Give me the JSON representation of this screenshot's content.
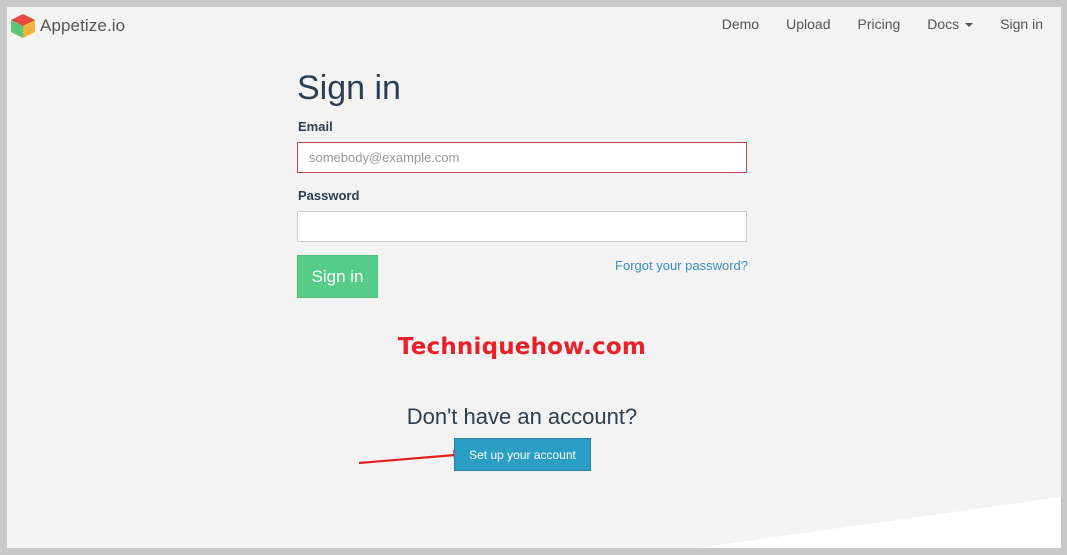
{
  "navbar": {
    "brand": "Appetize.io",
    "links": [
      "Demo",
      "Upload",
      "Pricing",
      "Docs",
      "Sign in"
    ]
  },
  "form": {
    "title": "Sign in",
    "email_label": "Email",
    "email_placeholder": "somebody@example.com",
    "email_value": "",
    "password_label": "Password",
    "password_value": "",
    "submit_label": "Sign in",
    "forgot_label": "Forgot your password?"
  },
  "watermark": "Techniquehow.com",
  "signup": {
    "prompt": "Don't have an account?",
    "button_label": "Set up your account"
  },
  "colors": {
    "signin_button": "#55cc88",
    "setup_button": "#2a9ec5",
    "email_border_error": "#b94a48",
    "link": "#3a8ec2",
    "watermark": "#e8202a",
    "annotation_arrow": "#e02020"
  },
  "icons": {
    "brand_logo": "cube-logo-icon",
    "docs_dropdown": "caret-down-icon",
    "annotation": "red-arrow-icon"
  }
}
